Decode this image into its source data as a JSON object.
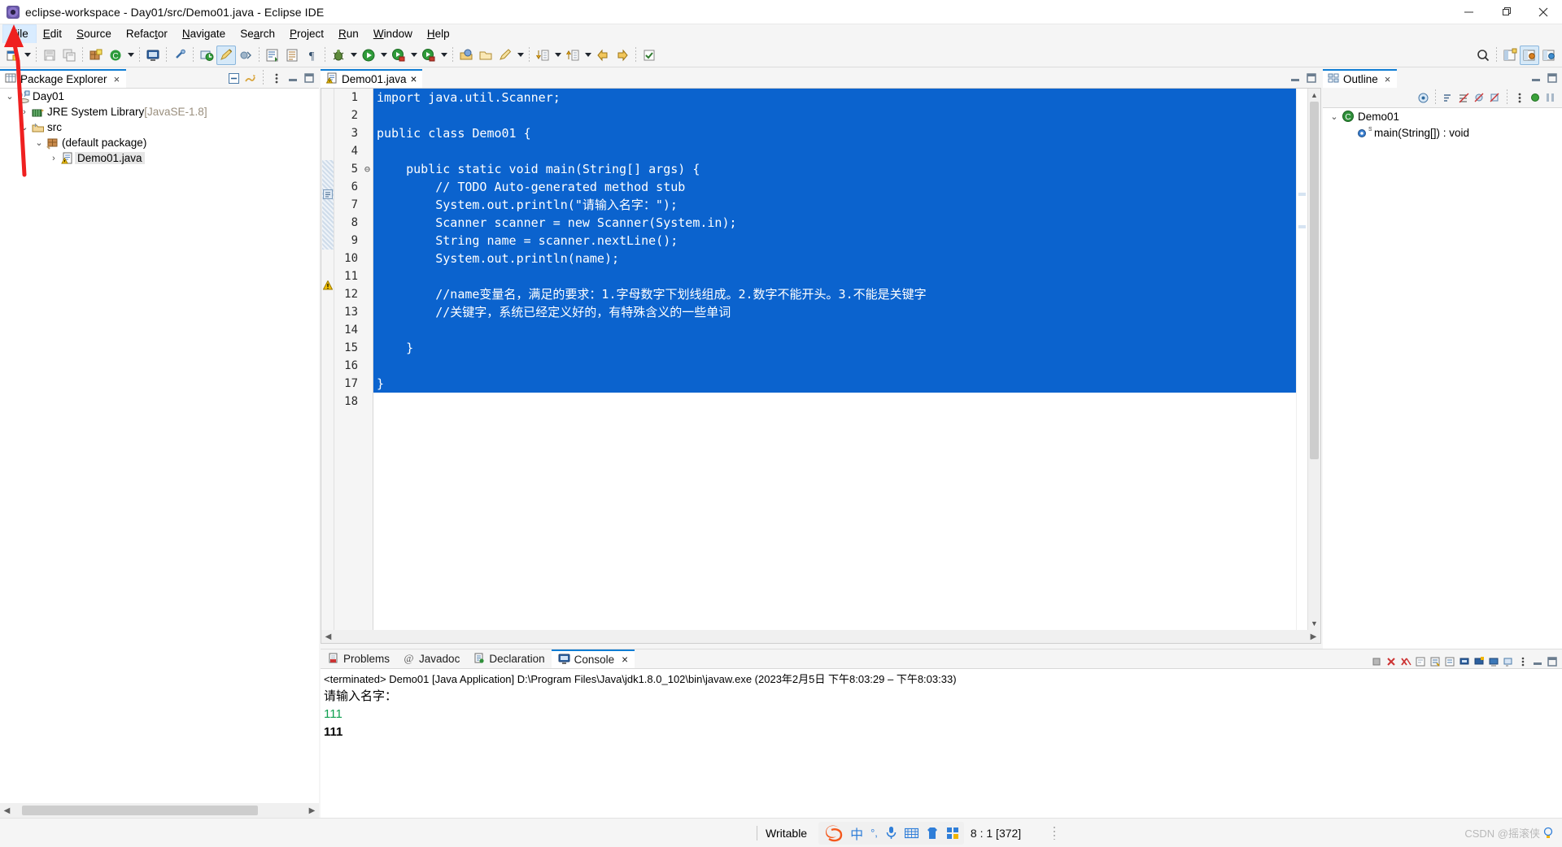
{
  "window": {
    "title": "eclipse-workspace - Day01/src/Demo01.java - Eclipse IDE",
    "app_icon": "eclipse-icon",
    "minimize_label": "Minimize",
    "maximize_label": "Restore",
    "close_label": "Close"
  },
  "menubar": {
    "items": [
      {
        "label": "File",
        "mnemonic": "F",
        "active": true
      },
      {
        "label": "Edit",
        "mnemonic": "E",
        "active": false
      },
      {
        "label": "Source",
        "mnemonic": "S",
        "active": false
      },
      {
        "label": "Refactor",
        "mnemonic": "t",
        "active": false
      },
      {
        "label": "Navigate",
        "mnemonic": "N",
        "active": false
      },
      {
        "label": "Search",
        "mnemonic": "a",
        "active": false
      },
      {
        "label": "Project",
        "mnemonic": "P",
        "active": false
      },
      {
        "label": "Run",
        "mnemonic": "R",
        "active": false
      },
      {
        "label": "Window",
        "mnemonic": "W",
        "active": false
      },
      {
        "label": "Help",
        "mnemonic": "H",
        "active": false
      }
    ]
  },
  "toolbar": {
    "buttons": [
      "new-wizard-icon",
      "new-dropdown-arrow",
      "save-icon",
      "save-all-icon",
      "new-java-package-icon",
      "new-java-class-icon",
      "new-class-dropdown-arrow",
      "console-icon",
      "link-icon",
      "external-tools-icon",
      "quick-access-pencil-icon",
      "skip-breakpoints-icon",
      "next-annotation-icon",
      "previous-annotation-icon",
      "paragraph-mark-icon",
      "debug-icon",
      "debug-dropdown-arrow",
      "run-icon",
      "run-dropdown-arrow",
      "run-as-icon",
      "run-as-dropdown-arrow",
      "coverage-icon",
      "coverage-dropdown-arrow",
      "open-type-icon",
      "open-task-icon",
      "search-icon",
      "search-dropdown-arrow",
      "next-edit-icon",
      "next-edit-dropdown-arrow",
      "previous-edit-icon",
      "previous-edit-dropdown-arrow",
      "back-icon",
      "forward-icon",
      "toggle-mark-icon"
    ],
    "right_buttons": [
      "quick-access-search-icon",
      "open-perspective-icon",
      "java-perspective-icon",
      "java-ee-perspective-icon"
    ]
  },
  "package_explorer": {
    "tab_label": "Package Explorer",
    "tab_icon": "package-explorer-icon",
    "close_label": "×",
    "view_tools": [
      "collapse-all-icon",
      "link-with-editor-icon",
      "view-menu-icon",
      "minimize-icon",
      "maximize-icon"
    ],
    "tree": [
      {
        "depth": 0,
        "twisty": "v",
        "icon": "java-project-icon",
        "label": "Day01",
        "suffix": "",
        "selected": false
      },
      {
        "depth": 1,
        "twisty": ">",
        "icon": "jre-library-icon",
        "label": "JRE System Library",
        "suffix": "[JavaSE-1.8]",
        "selected": false
      },
      {
        "depth": 1,
        "twisty": "v",
        "icon": "source-folder-icon",
        "label": "src",
        "suffix": "",
        "selected": false
      },
      {
        "depth": 2,
        "twisty": "v",
        "icon": "package-icon",
        "label": "(default package)",
        "suffix": "",
        "selected": false
      },
      {
        "depth": 3,
        "twisty": ">",
        "icon": "java-file-warning-icon",
        "label": "Demo01.java",
        "suffix": "",
        "selected": true
      }
    ]
  },
  "editor": {
    "tab_label": "Demo01.java",
    "tab_icon": "java-file-warning-icon",
    "close_label": "×",
    "minimize_icon": "minimize-icon",
    "maximize_icon": "maximize-icon",
    "lines": [
      {
        "n": 1,
        "text": "import java.util.Scanner;",
        "selected": true,
        "fold": ""
      },
      {
        "n": 2,
        "text": "",
        "selected": true,
        "fold": ""
      },
      {
        "n": 3,
        "text": "public class Demo01 {",
        "selected": true,
        "fold": ""
      },
      {
        "n": 4,
        "text": "",
        "selected": true,
        "fold": ""
      },
      {
        "n": 5,
        "text": "    public static void main(String[] args) {",
        "selected": true,
        "fold": "⊖"
      },
      {
        "n": 6,
        "text": "        // TODO Auto-generated method stub",
        "selected": true,
        "fold": ""
      },
      {
        "n": 7,
        "text": "        System.out.println(\"请输入名字：\");",
        "selected": true,
        "fold": ""
      },
      {
        "n": 8,
        "text": "        Scanner scanner = new Scanner(System.in);",
        "selected": true,
        "fold": ""
      },
      {
        "n": 9,
        "text": "        String name = scanner.nextLine();",
        "selected": true,
        "fold": ""
      },
      {
        "n": 10,
        "text": "        System.out.println(name);",
        "selected": true,
        "fold": ""
      },
      {
        "n": 11,
        "text": "",
        "selected": true,
        "fold": ""
      },
      {
        "n": 12,
        "text": "        //name变量名，满足的要求：1.字母数字下划线组成。2.数字不能开头。3.不能是关键字",
        "selected": true,
        "fold": ""
      },
      {
        "n": 13,
        "text": "        //关键字，系统已经定义好的，有特殊含义的一些单词",
        "selected": true,
        "fold": ""
      },
      {
        "n": 14,
        "text": "",
        "selected": true,
        "fold": ""
      },
      {
        "n": 15,
        "text": "    }",
        "selected": true,
        "fold": ""
      },
      {
        "n": 16,
        "text": "",
        "selected": true,
        "fold": ""
      },
      {
        "n": 17,
        "text": "}",
        "selected": true,
        "fold": ""
      },
      {
        "n": 18,
        "text": "",
        "selected": false,
        "fold": ""
      }
    ]
  },
  "console": {
    "tabs": [
      {
        "label": "Problems",
        "icon": "problems-icon",
        "active": false
      },
      {
        "label": "Javadoc",
        "icon": "javadoc-icon",
        "active": false
      },
      {
        "label": "Declaration",
        "icon": "declaration-icon",
        "active": false
      },
      {
        "label": "Console",
        "icon": "console-icon",
        "active": true
      }
    ],
    "close_label": "×",
    "tools": [
      "terminate-icon",
      "remove-launch-icon",
      "remove-all-terminated-icon",
      "clear-console-icon",
      "scroll-lock-icon",
      "word-wrap-icon",
      "show-console-on-output-icon",
      "pin-console-icon",
      "display-selected-console-icon",
      "open-console-dropdown-icon",
      "view-menu-icon",
      "minimize-icon",
      "maximize-icon"
    ],
    "header": "<terminated> Demo01 [Java Application] D:\\Program Files\\Java\\jdk1.8.0_102\\bin\\javaw.exe  (2023年2月5日 下午8:03:29 – 下午8:03:33)",
    "output": [
      {
        "text": "请输入名字：",
        "style": "plain"
      },
      {
        "text": "111",
        "style": "green"
      },
      {
        "text": "111",
        "style": "bold"
      }
    ]
  },
  "outline": {
    "tab_label": "Outline",
    "tab_icon": "outline-icon",
    "close_label": "×",
    "tools": [
      "focus-active-task-icon",
      "sort-icon",
      "hide-fields-icon",
      "hide-static-icon",
      "hide-nonpublic-icon",
      "view-menu-icon",
      "minimize-icon",
      "maximize-icon"
    ],
    "items": [
      {
        "depth": 0,
        "twisty": "v",
        "icon": "class-icon",
        "label": "Demo01"
      },
      {
        "depth": 1,
        "twisty": "",
        "icon": "method-public-static-icon",
        "label": "main(String[]) : void"
      }
    ]
  },
  "statusbar": {
    "writable": "Writable",
    "ime": {
      "logo": "sogou-ime-icon",
      "items": [
        "中",
        "°,",
        "microphone-icon",
        "keyboard-icon",
        "skin-icon",
        "apps-icon"
      ]
    },
    "position": "8 : 1 [372]",
    "watermark": "CSDN @摇滚侠"
  },
  "annotation": {
    "arrow": "red-arrow-pointing-to-file-menu",
    "color": "#ef2020"
  },
  "colors": {
    "selection_blue": "#0b63ce",
    "tab_accent": "#0f7dd4",
    "dim_text": "#9a8f7e",
    "console_green": "#10a050"
  }
}
